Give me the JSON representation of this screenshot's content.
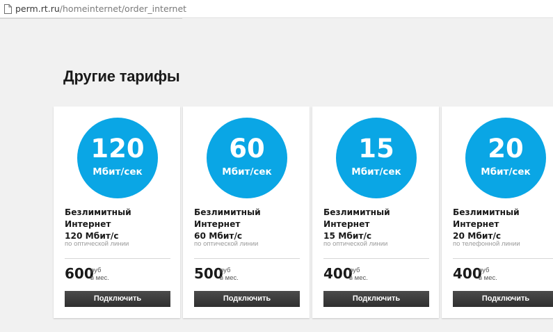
{
  "browser": {
    "url_host": "perm.rt.ru",
    "url_path": "/homeinternet/order_internet",
    "page_icon": "page-icon"
  },
  "section": {
    "title": "Другие тарифы"
  },
  "tariffs": [
    {
      "speed": "120",
      "unit": "Мбит/сек",
      "name_line1": "Безлимитный Интернет",
      "name_line2": "120 Мбит/с",
      "technology": "по оптической линии",
      "price": "600",
      "currency": "руб",
      "period": "в мес.",
      "button_label": "Подключить"
    },
    {
      "speed": "60",
      "unit": "Мбит/сек",
      "name_line1": "Безлимитный Интернет",
      "name_line2": "60 Мбит/с",
      "technology": "по оптической линии",
      "price": "500",
      "currency": "руб",
      "period": "в мес.",
      "button_label": "Подключить"
    },
    {
      "speed": "15",
      "unit": "Мбит/сек",
      "name_line1": "Безлимитный Интернет",
      "name_line2": "15 Мбит/с",
      "technology": "по оптической линии",
      "price": "400",
      "currency": "руб",
      "period": "в мес.",
      "button_label": "Подключить"
    },
    {
      "speed": "20",
      "unit": "Мбит/сек",
      "name_line1": "Безлимитный Интернет",
      "name_line2": "20 Мбит/с",
      "technology": "по телефонной линии",
      "price": "400",
      "currency": "руб",
      "period": "в мес.",
      "button_label": "Подключить"
    }
  ],
  "colors": {
    "accent": "#0aa6e5",
    "button": "#3a3a3a",
    "background": "#f1f1f1"
  }
}
